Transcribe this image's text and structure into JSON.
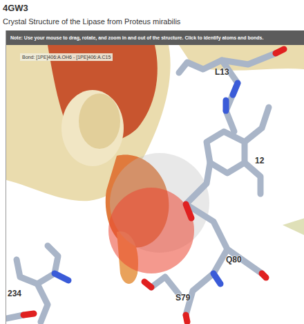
{
  "page": {
    "title": "4GW3",
    "subtitle": "Crystal Structure of the Lipase from Proteus mirabilis"
  },
  "viewer": {
    "note": "Note: Use your mouse to drag, rotate, and zoom in and out of the structure. Click to identify atoms and bonds.",
    "tooltip": "Bond: [1PE]406:A.OH6 - [1PE]406:A.C15",
    "residue_labels": [
      "L13",
      "12",
      "Q80",
      "S79",
      "234"
    ]
  }
}
